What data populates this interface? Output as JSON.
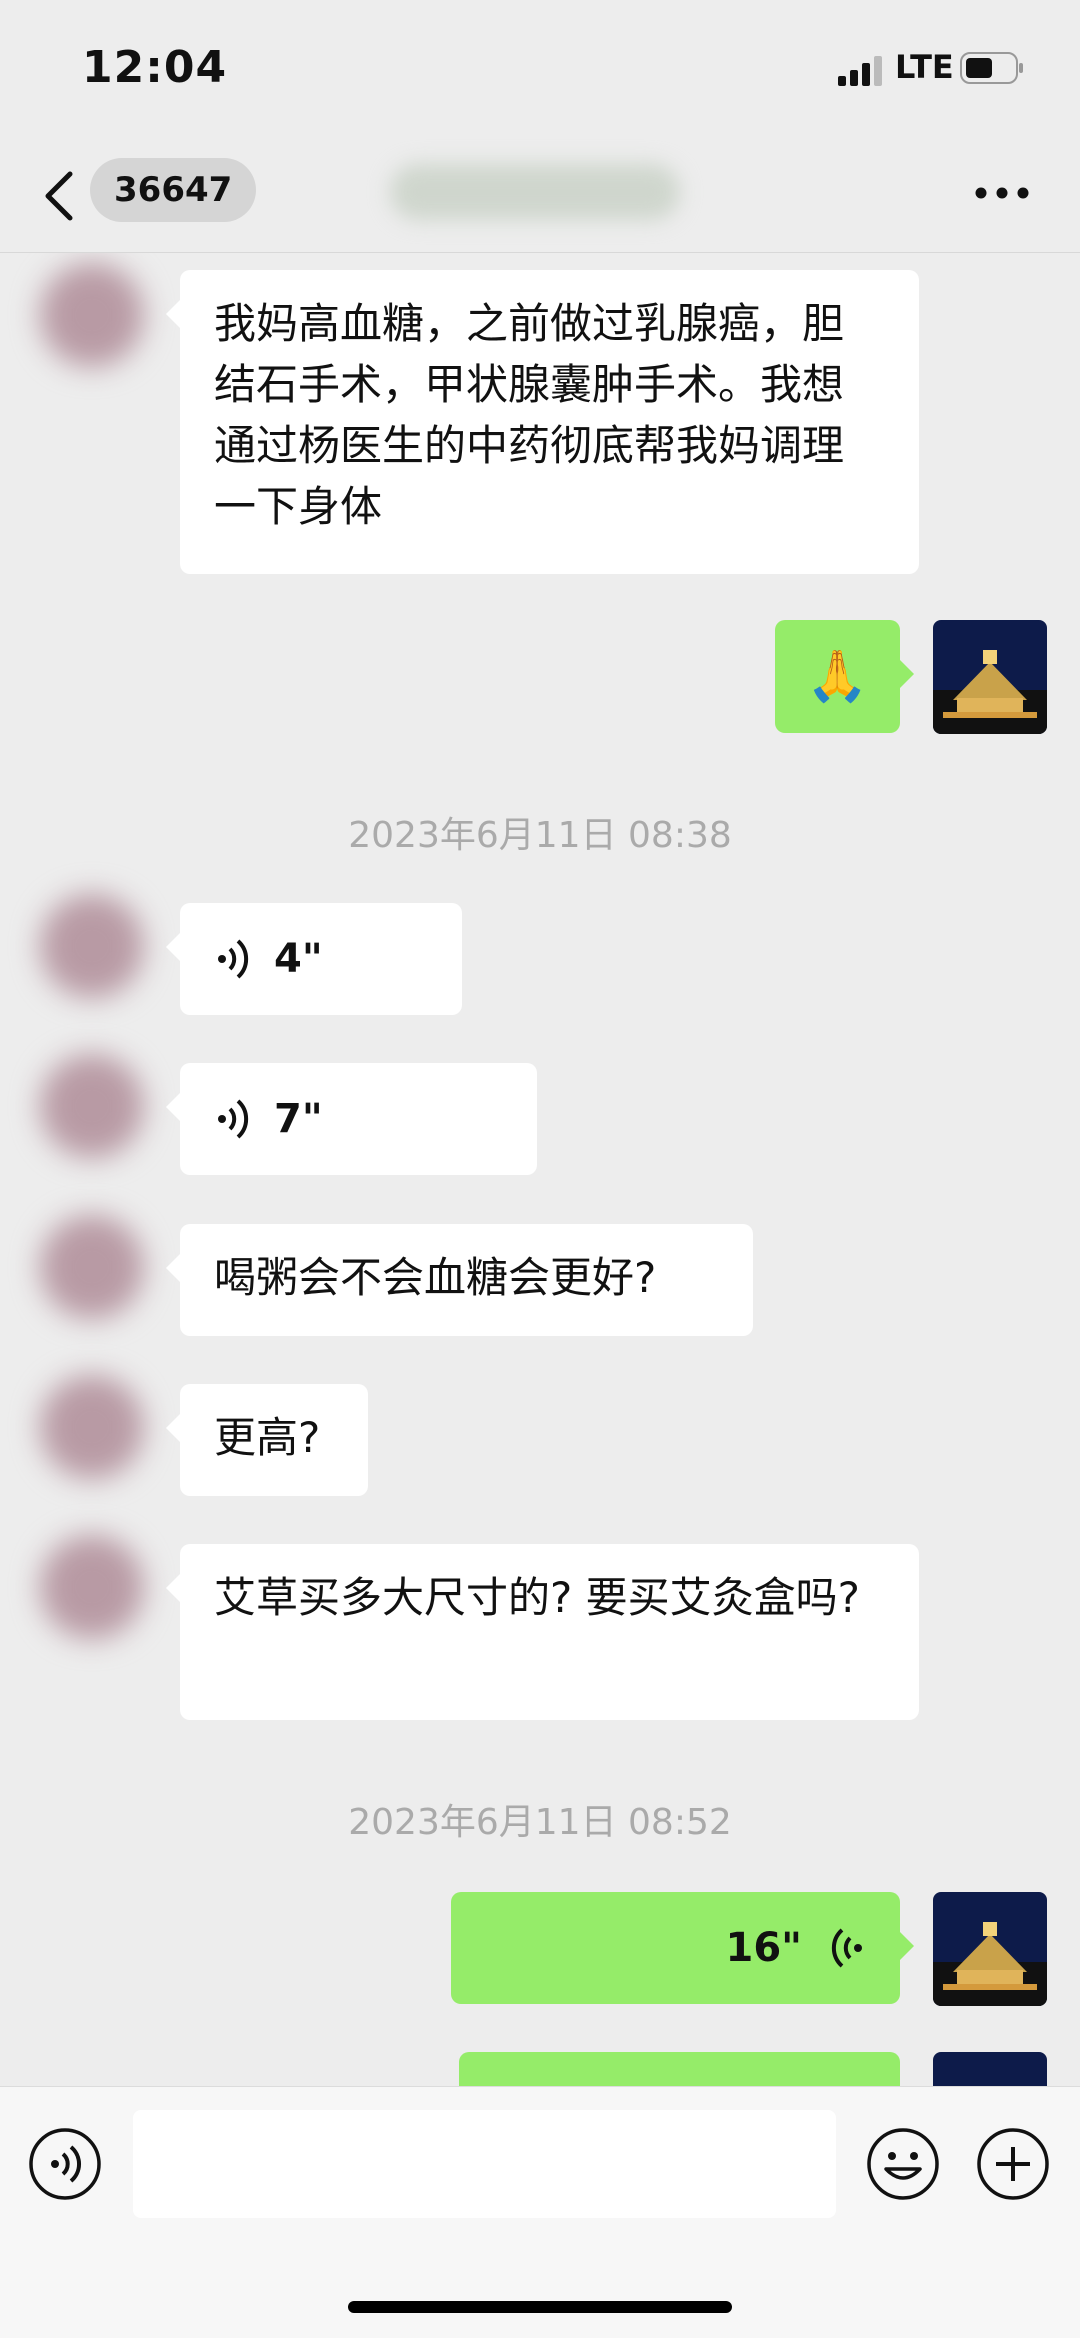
{
  "status_bar": {
    "time": "12:04",
    "network": "LTE"
  },
  "header": {
    "badge": "36647",
    "title": ""
  },
  "messages": [
    {
      "side": "in",
      "type": "text",
      "text": "我妈高血糖，之前做过乳腺癌，胆结石手术，甲状腺囊肿手术。我想通过杨医生的中药彻底帮我妈调理一下身体"
    },
    {
      "side": "out",
      "type": "emoji",
      "text": "🙏"
    },
    {
      "type": "timestamp",
      "text": "2023年6月11日 08:38"
    },
    {
      "side": "in",
      "type": "voice",
      "duration": "4\""
    },
    {
      "side": "in",
      "type": "voice",
      "duration": "7\""
    },
    {
      "side": "in",
      "type": "text",
      "text": "喝粥会不会血糖会更好?"
    },
    {
      "side": "in",
      "type": "text",
      "text": "更高?"
    },
    {
      "side": "in",
      "type": "text",
      "text": "艾草买多大尺寸的? 要买艾灸盒吗?"
    },
    {
      "type": "timestamp",
      "text": "2023年6月11日 08:52"
    },
    {
      "side": "out",
      "type": "voice",
      "duration": "16\""
    },
    {
      "side": "out",
      "type": "voice",
      "duration": ""
    }
  ],
  "input_bar": {
    "voice_icon": "voice-mode-icon",
    "emoji_icon": "emoji-icon",
    "plus_icon": "plus-icon",
    "input_value": ""
  },
  "colors": {
    "background": "#ededed",
    "incoming": "#ffffff",
    "outgoing": "#95ec69",
    "timestamp": "#aaaaaa"
  }
}
